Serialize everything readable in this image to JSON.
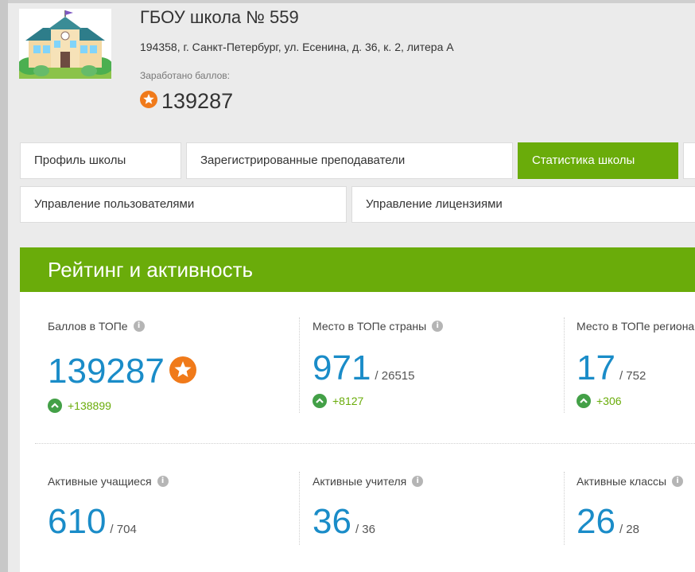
{
  "school": {
    "title": "ГБОУ школа № 559",
    "address": "194358, г. Санкт-Петербург, ул. Есенина, д. 36, к. 2, литера А",
    "earned_label": "Заработано баллов:",
    "earned_value": "139287",
    "logo_icon": "school-building-icon"
  },
  "tabs": {
    "profile": "Профиль школы",
    "teachers": "Зарегистрированные преподаватели",
    "stats": "Статистика школы",
    "users": "Управление пользователями",
    "licenses": "Управление лицензиями"
  },
  "rating": {
    "title": "Рейтинг и активность",
    "top_points": {
      "label": "Баллов в ТОПе",
      "value": "139287",
      "delta": "+138899"
    },
    "country_place": {
      "label": "Место в ТОПе страны",
      "value": "971",
      "total": "/ 26515",
      "delta": "+8127"
    },
    "region_place": {
      "label": "Место в ТОПе региона",
      "value": "17",
      "total": "/ 752",
      "delta": "+306"
    },
    "active_students": {
      "label": "Активные учащиеся",
      "value": "610",
      "total": "/ 704"
    },
    "active_teachers": {
      "label": "Активные учителя",
      "value": "36",
      "total": "/ 36"
    },
    "active_classes": {
      "label": "Активные классы",
      "value": "26",
      "total": "/ 28"
    }
  },
  "colors": {
    "accent_green": "#6aac0a",
    "value_blue": "#1a8cc8",
    "badge_orange": "#f07a1a"
  }
}
